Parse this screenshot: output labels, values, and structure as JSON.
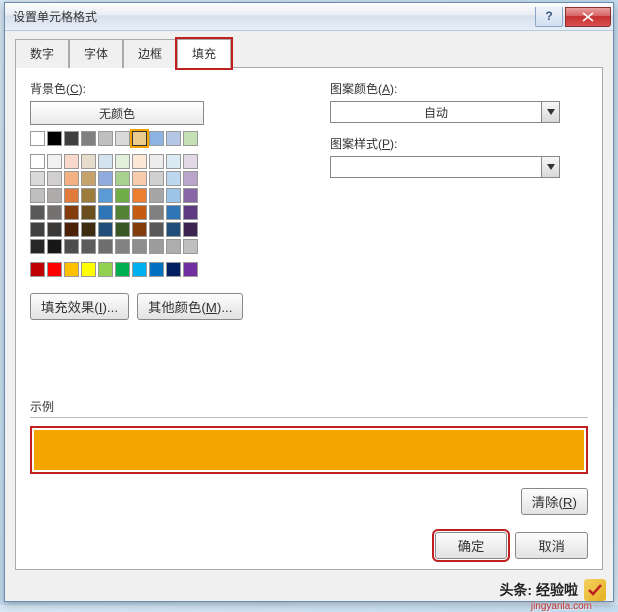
{
  "title": "设置单元格格式",
  "help_symbol": "?",
  "tabs": [
    "数字",
    "字体",
    "边框",
    "填充"
  ],
  "active_tab_index": 3,
  "labels": {
    "bg_color": "背景色(C):",
    "no_color": "无颜色",
    "pattern_color": "图案颜色(A):",
    "pattern_style": "图案样式(P):",
    "auto": "自动",
    "example": "示例"
  },
  "buttons": {
    "fill_effects": "填充效果(I)...",
    "other_colors": "其他颜色(M)...",
    "clear": "清除(R)",
    "ok": "确定",
    "cancel": "取消"
  },
  "selected_color": "#f5a500",
  "palette_large_row": [
    "#ffffff",
    "#000000",
    "#404040",
    "#808080",
    "#bfbfbf",
    "#d9d9d9",
    "#eccc8e",
    "#8db3e2",
    "#b4c7e7",
    "#c5e0b4"
  ],
  "palette_main": [
    [
      "#ffffff",
      "#f2f2f2",
      "#f9d9cc",
      "#e6dccb",
      "#d5e3f0",
      "#e2efda",
      "#fce8d5",
      "#ededed",
      "#dbebf4",
      "#e2d8e6"
    ],
    [
      "#d9d9d9",
      "#d0cece",
      "#f4b183",
      "#c5a36a",
      "#8faadc",
      "#a9d18e",
      "#f8cbad",
      "#d0d0d0",
      "#bdd7ee",
      "#b9a6ca"
    ],
    [
      "#bfbfbf",
      "#afabab",
      "#e07b3c",
      "#9c7c3a",
      "#5b9bd5",
      "#70ad47",
      "#ed7d31",
      "#a6a6a6",
      "#9dc3e6",
      "#8966a6"
    ],
    [
      "#595959",
      "#767171",
      "#843c0c",
      "#6b4e1e",
      "#2e75b6",
      "#548235",
      "#c55a11",
      "#808080",
      "#2e75b6",
      "#5e3a82"
    ],
    [
      "#404040",
      "#3b3838",
      "#4d2108",
      "#3e2c10",
      "#1f4e79",
      "#385723",
      "#833c0c",
      "#595959",
      "#1f4e79",
      "#3b2450"
    ],
    [
      "#262626",
      "#171717",
      "#4d4d4d",
      "#5c5c5c",
      "#6e6e6e",
      "#828282",
      "#8e8e8e",
      "#9c9c9c",
      "#adadad",
      "#bfbfbf"
    ]
  ],
  "palette_std": [
    "#c00000",
    "#ff0000",
    "#ffc000",
    "#ffff00",
    "#92d050",
    "#00b050",
    "#00b0f0",
    "#0070c0",
    "#002060",
    "#7030a0"
  ],
  "watermark": {
    "text": "头条: 经验啦",
    "url": "jingyanla.com"
  }
}
